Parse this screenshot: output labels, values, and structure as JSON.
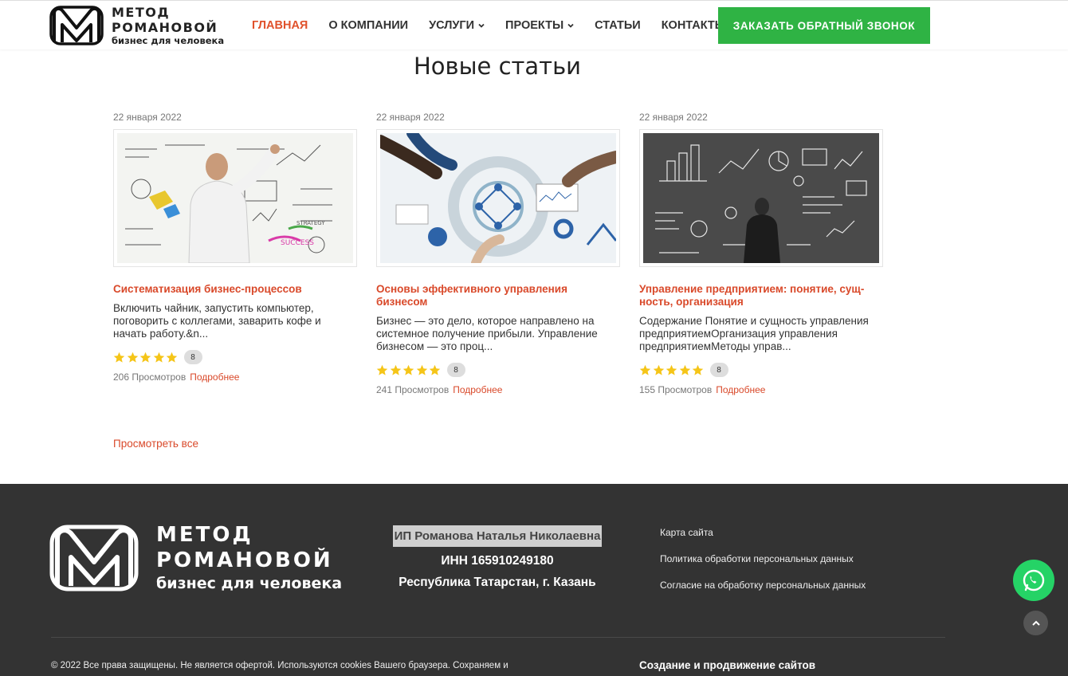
{
  "brand": {
    "line1": "МЕТОД",
    "line2": "РОМАНОВОЙ",
    "tagline": "бизнес для человека"
  },
  "nav": {
    "items": [
      {
        "label": "ГЛАВНАЯ",
        "active": true
      },
      {
        "label": "О КОМПАНИИ"
      },
      {
        "label": "УСЛУГИ",
        "dropdown": true
      },
      {
        "label": "ПРОЕКТЫ",
        "dropdown": true
      },
      {
        "label": "СТАТЬИ"
      },
      {
        "label": "КОНТАКТЫ"
      }
    ],
    "cta": "ЗАКАЗАТЬ ОБРАТНЫЙ ЗВОНОК"
  },
  "articles": {
    "title": "Новые статьи",
    "items": [
      {
        "date": "22 января 2022",
        "title": "Систематизация бизнес-процессов",
        "excerpt": " Включить чайник, запустить компьютер, поговорить с коллегами, заварить кофе и начать работу.&n...",
        "rating": 5,
        "votes": "8",
        "views": "206 Просмотров",
        "more": "Подробнее"
      },
      {
        "date": "22 января 2022",
        "title": "Основы эффективного управления бизнесом",
        "excerpt": "Бизнес — это дело, которое направлено на системное получение прибыли. Управление бизнесом — это проц...",
        "rating": 5,
        "votes": "8",
        "views": "241 Просмотров",
        "more": "Подробнее"
      },
      {
        "date": "22 января 2022",
        "title": "Управление предприятием: понятие, сущ-ность, организация",
        "excerpt": "Содержание Понятие и сущность управления предприятиемОрганизация управления предприятиемМетоды управ...",
        "rating": 5,
        "votes": "8",
        "views": "155 Просмотров",
        "more": "Подробнее"
      }
    ],
    "view_all": "Просмотреть все"
  },
  "footer": {
    "company_name": "ИП Романова Наталья Николаевна",
    "inn": "ИНН 165910249180",
    "region": "Республика Татарстан, г. Казань",
    "links": [
      "Карта сайта",
      "Политика обработки персональных данных",
      "Согласие на обработку персональных данных"
    ],
    "copyright": "© 2022 Все права защищены. Не является офертой. Используются cookies Вашего браузера. Сохраняем и",
    "dev": "Создание и продвижение сайтов"
  },
  "colors": {
    "accent": "#e0512b",
    "cta": "#2fb344",
    "footer_bg": "#333333",
    "star": "#f5c518",
    "whatsapp": "#25d366"
  }
}
